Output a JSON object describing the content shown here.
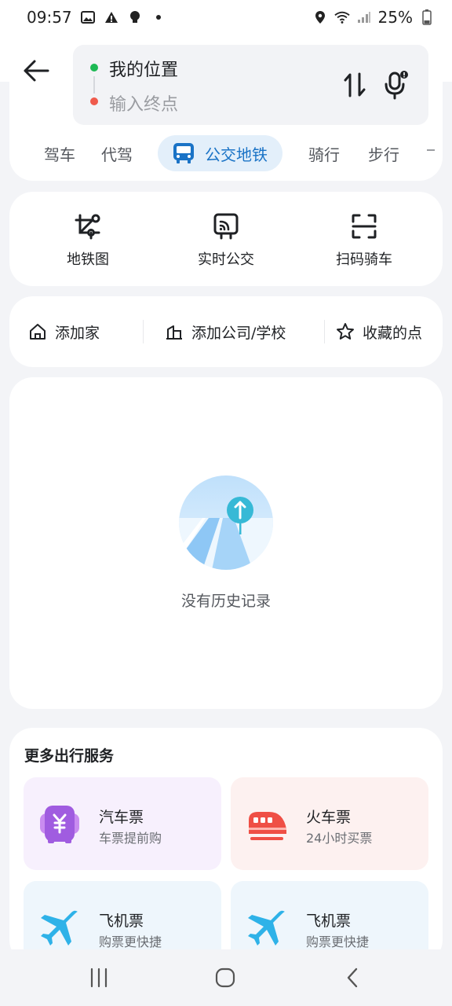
{
  "status_bar": {
    "time": "09:57",
    "battery": "25%",
    "icons": [
      "image-icon",
      "warning-icon",
      "bulb-icon",
      "dot-icon",
      "location-icon",
      "wifi-icon",
      "signal-icon",
      "battery-icon"
    ]
  },
  "route": {
    "origin": "我的位置",
    "destination_placeholder": "输入终点"
  },
  "mode_tabs": [
    {
      "label": "驾车"
    },
    {
      "label": "代驾"
    },
    {
      "label": "公交地铁",
      "active": true
    },
    {
      "label": "骑行"
    },
    {
      "label": "步行"
    }
  ],
  "tools": [
    {
      "label": "地铁图",
      "icon": "metro-map-icon"
    },
    {
      "label": "实时公交",
      "icon": "realtime-bus-icon"
    },
    {
      "label": "扫码骑车",
      "icon": "scan-icon"
    }
  ],
  "favorites": [
    {
      "label": "添加家",
      "icon": "home-icon"
    },
    {
      "label": "添加公司/学校",
      "icon": "building-icon"
    },
    {
      "label": "收藏的点",
      "icon": "star-icon"
    }
  ],
  "history": {
    "empty_text": "没有历史记录"
  },
  "services": {
    "title": "更多出行服务",
    "items": [
      {
        "title": "汽车票",
        "subtitle": "车票提前购",
        "icon": "bus-ticket-icon",
        "bg": "#f7f0fd"
      },
      {
        "title": "火车票",
        "subtitle": "24小时买票",
        "icon": "train-icon",
        "bg": "#fdf1f0"
      },
      {
        "title": "飞机票",
        "subtitle": "购票更快捷",
        "icon": "plane-icon",
        "bg": "#eef6fc"
      },
      {
        "title": "飞机票",
        "subtitle": "购票更快捷",
        "icon": "plane-icon",
        "bg": "#eef6fc"
      }
    ]
  },
  "colors": {
    "accent": "#1a73c6",
    "origin_dot": "#1db954",
    "dest_dot": "#ef5a4c"
  }
}
